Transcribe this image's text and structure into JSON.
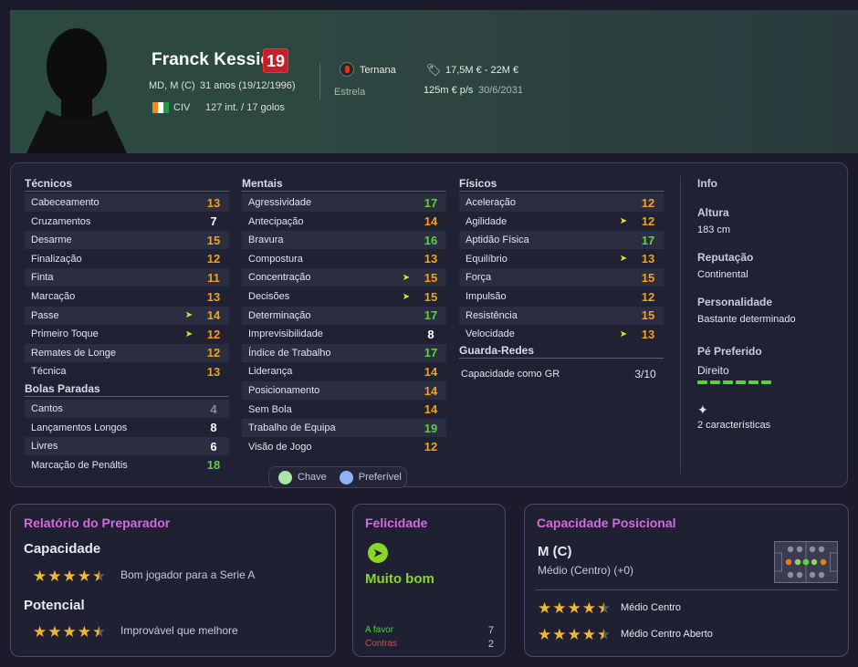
{
  "player": {
    "name": "Franck Kessié",
    "number": "19",
    "position": "MD, M (C)",
    "age": "31 anos (19/12/1996)",
    "nationality": "CIV",
    "caps": "127 int. / 17 golos",
    "club": "Ternana",
    "role": "Estrela",
    "value": "17,5M € - 22M €",
    "wage": "125m € p/s",
    "contract": "30/6/2031"
  },
  "tecnicos": {
    "title": "Técnicos",
    "rows": [
      {
        "label": "Cabeceamento",
        "value": "13",
        "color": "orange",
        "key": false
      },
      {
        "label": "Cruzamentos",
        "value": "7",
        "color": "white",
        "key": false
      },
      {
        "label": "Desarme",
        "value": "15",
        "color": "orange",
        "key": false
      },
      {
        "label": "Finalização",
        "value": "12",
        "color": "orange",
        "key": false
      },
      {
        "label": "Finta",
        "value": "11",
        "color": "orange",
        "key": false
      },
      {
        "label": "Marcação",
        "value": "13",
        "color": "orange",
        "key": false
      },
      {
        "label": "Passe",
        "value": "14",
        "color": "orange",
        "key": true
      },
      {
        "label": "Primeiro Toque",
        "value": "12",
        "color": "orange",
        "key": true
      },
      {
        "label": "Remates de Longe",
        "value": "12",
        "color": "orange",
        "key": false
      },
      {
        "label": "Técnica",
        "value": "13",
        "color": "orange",
        "key": false
      }
    ]
  },
  "bolas_paradas": {
    "title": "Bolas Paradas",
    "rows": [
      {
        "label": "Cantos",
        "value": "4",
        "color": "grey",
        "key": false
      },
      {
        "label": "Lançamentos Longos",
        "value": "8",
        "color": "white",
        "key": false
      },
      {
        "label": "Livres",
        "value": "6",
        "color": "white",
        "key": false
      },
      {
        "label": "Marcação de Penáltis",
        "value": "18",
        "color": "green",
        "key": false
      }
    ]
  },
  "mentais": {
    "title": "Mentais",
    "rows": [
      {
        "label": "Agressividade",
        "value": "17",
        "color": "green",
        "key": false
      },
      {
        "label": "Antecipação",
        "value": "14",
        "color": "orange",
        "key": false
      },
      {
        "label": "Bravura",
        "value": "16",
        "color": "green",
        "key": false
      },
      {
        "label": "Compostura",
        "value": "13",
        "color": "orange",
        "key": false
      },
      {
        "label": "Concentração",
        "value": "15",
        "color": "orange",
        "key": true
      },
      {
        "label": "Decisões",
        "value": "15",
        "color": "orange",
        "key": true
      },
      {
        "label": "Determinação",
        "value": "17",
        "color": "green",
        "key": false
      },
      {
        "label": "Imprevisibilidade",
        "value": "8",
        "color": "white",
        "key": false
      },
      {
        "label": "Índice de Trabalho",
        "value": "17",
        "color": "green",
        "key": false
      },
      {
        "label": "Liderança",
        "value": "14",
        "color": "orange",
        "key": false
      },
      {
        "label": "Posicionamento",
        "value": "14",
        "color": "orange",
        "key": false
      },
      {
        "label": "Sem Bola",
        "value": "14",
        "color": "orange",
        "key": false
      },
      {
        "label": "Trabalho de Equipa",
        "value": "19",
        "color": "green",
        "key": false
      },
      {
        "label": "Visão de Jogo",
        "value": "12",
        "color": "orange",
        "key": false
      }
    ]
  },
  "fisicos": {
    "title": "Físicos",
    "rows": [
      {
        "label": "Aceleração",
        "value": "12",
        "color": "orange",
        "key": false
      },
      {
        "label": "Agilidade",
        "value": "12",
        "color": "orange",
        "key": true
      },
      {
        "label": "Aptidão Física",
        "value": "17",
        "color": "green",
        "key": false
      },
      {
        "label": "Equilíbrio",
        "value": "13",
        "color": "orange",
        "key": true
      },
      {
        "label": "Força",
        "value": "15",
        "color": "orange",
        "key": false
      },
      {
        "label": "Impulsão",
        "value": "12",
        "color": "orange",
        "key": false
      },
      {
        "label": "Resistência",
        "value": "15",
        "color": "orange",
        "key": false
      },
      {
        "label": "Velocidade",
        "value": "13",
        "color": "orange",
        "key": true
      }
    ]
  },
  "guarda_redes": {
    "title": "Guarda-Redes",
    "label": "Capacidade como GR",
    "value": "3/10"
  },
  "info": {
    "title": "Info",
    "altura_label": "Altura",
    "altura": "183 cm",
    "reputacao_label": "Reputação",
    "reputacao": "Continental",
    "personalidade_label": "Personalidade",
    "personalidade": "Bastante determinado",
    "pe_label": "Pé Preferido",
    "pe": "Direito",
    "caracteristicas": "2 características"
  },
  "legend": {
    "chave": "Chave",
    "preferivel": "Preferível"
  },
  "relatorio": {
    "title": "Relatório do Preparador",
    "capacidade_label": "Capacidade",
    "capacidade_stars": 4.5,
    "capacidade_text": "Bom jogador para a Serie A",
    "potencial_label": "Potencial",
    "potencial_stars": 4.5,
    "potencial_text": "Improvável que melhore"
  },
  "felicidade": {
    "title": "Felicidade",
    "status": "Muito bom",
    "favor_label": "A favor",
    "favor": "7",
    "contras_label": "Contras",
    "contras": "2"
  },
  "posicional": {
    "title": "Capacidade Posicional",
    "position": "M (C)",
    "sub": "Médio (Centro) (+0)",
    "roles": [
      {
        "stars": 4.5,
        "label": "Médio Centro"
      },
      {
        "stars": 4.5,
        "label": "Médio Centro Aberto"
      }
    ]
  },
  "colors": {
    "orange": "#f0a21a",
    "green": "#5bd13a",
    "white": "#ffffff",
    "grey": "#8b8e9f",
    "title_pink": "#d668e0",
    "felicidade_green": "#8ad62a",
    "key_dot": "#a8e6a3",
    "pref_dot": "#8fb4f2"
  }
}
